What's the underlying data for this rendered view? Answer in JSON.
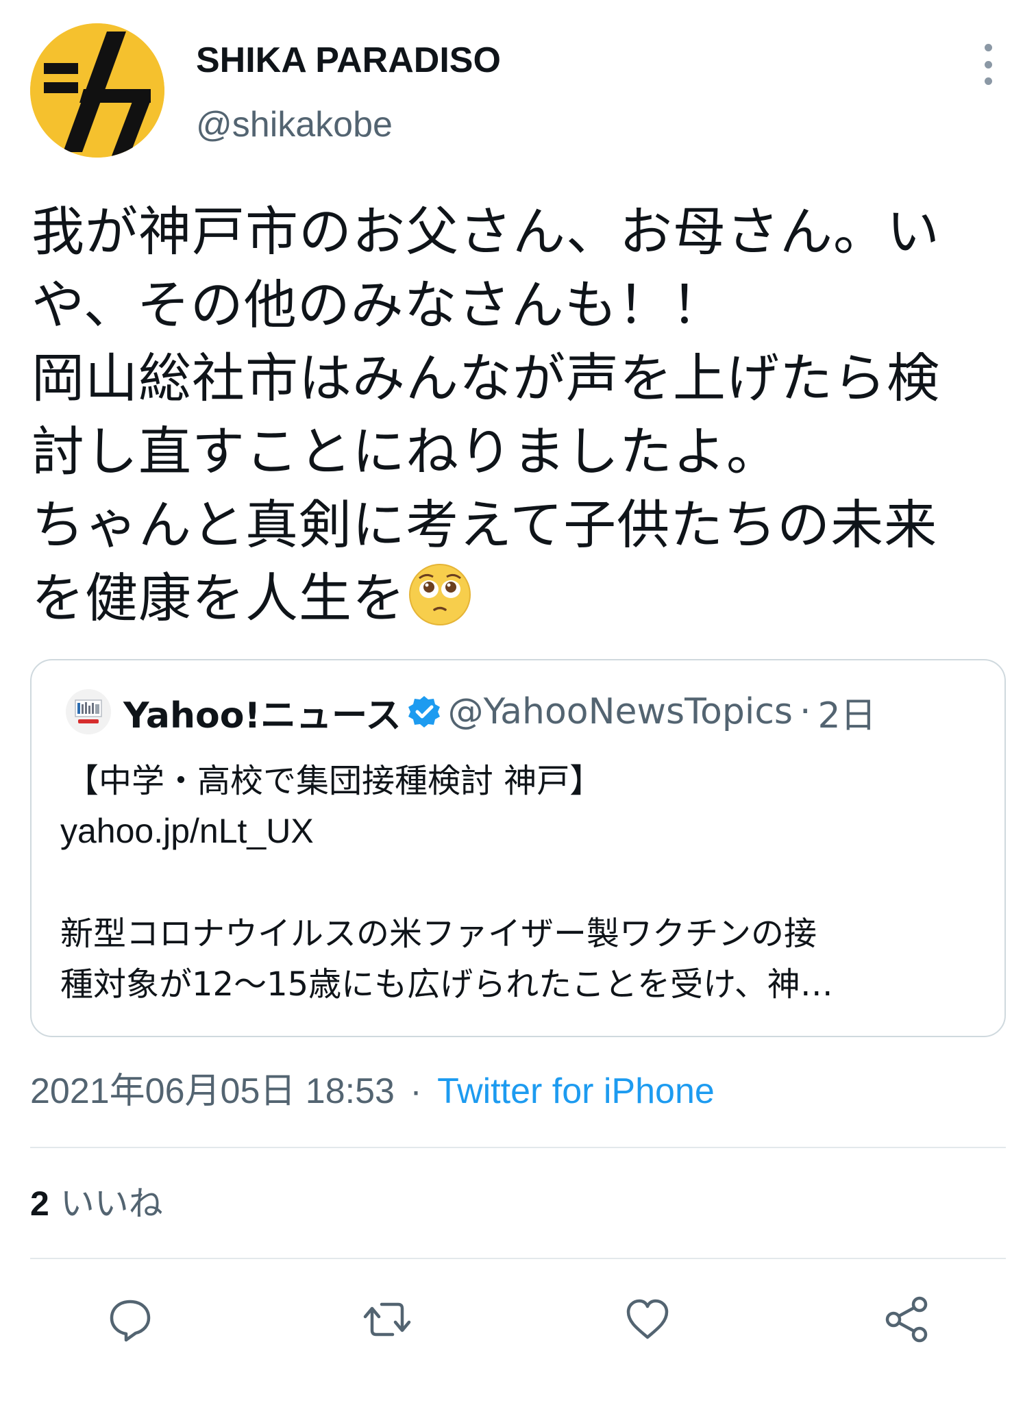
{
  "author": {
    "display_name": "SHIKA PARADISO",
    "handle": "@shikakobe",
    "avatar_icon": "shika-logo-icon",
    "avatar_color": "#f5c12e"
  },
  "tweet": {
    "lines": [
      "我が神戸市のお父さん、お母さん。い",
      "や、その他のみなさんも！！",
      "岡山総社市はみんなが声を上げたら検",
      "討し直すことにねりましたよ。",
      "ちゃんと真剣に考えて子供たちの未来",
      "を健康を人生を"
    ],
    "emoji": "pleading-face-emoji"
  },
  "quote": {
    "name": "Yahoo!ニュース",
    "verified_icon": "verified-badge-icon",
    "handle": "@YahooNewsTopics",
    "separator": "·",
    "time": "2日",
    "headline": "【中学・高校で集団接種検討 神戸】",
    "link": "yahoo.jp/nLt_UX",
    "body_lines": [
      "新型コロナウイルスの米ファイザー製ワクチンの接",
      "種対象が12～15歳にも広げられたことを受け、神…"
    ]
  },
  "meta": {
    "date": "2021年06月05日 18:53",
    "separator": "·",
    "source": "Twitter for iPhone"
  },
  "stats": {
    "likes_count": "2",
    "likes_label": "いいね"
  },
  "actions": [
    {
      "name": "reply",
      "icon": "reply-icon"
    },
    {
      "name": "retweet",
      "icon": "retweet-icon"
    },
    {
      "name": "like",
      "icon": "heart-icon"
    },
    {
      "name": "share",
      "icon": "share-icon"
    }
  ],
  "colors": {
    "text": "#0f1419",
    "secondary": "#536471",
    "link": "#1d9bf0",
    "border": "#cfd9de",
    "verified": "#1d9bf0"
  }
}
